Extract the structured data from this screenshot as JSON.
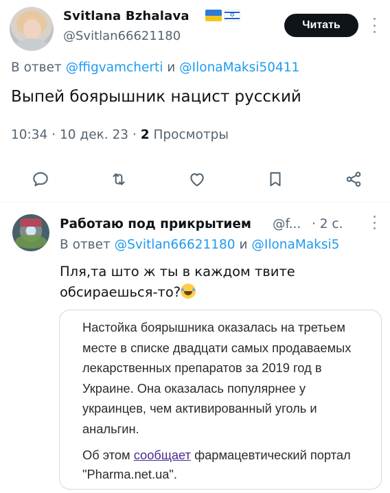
{
  "main_tweet": {
    "author_name": "Svitlana Bzhalava",
    "flags": [
      "ukraine-flag",
      "israel-flag"
    ],
    "handle": "@Svitlan66621180",
    "read_button": "Читать",
    "reply_prefix": "В ответ",
    "reply_mentions": [
      "@ffigvamcherti",
      "@IlonaMaksi50411"
    ],
    "reply_joiner": "и",
    "text": "Выпей боярышник нацист русский",
    "time": "10:34",
    "date": "10 дек. 23",
    "views_count": "2",
    "views_label": "Просмотры",
    "actions": [
      "reply-icon",
      "retweet-icon",
      "like-icon",
      "bookmark-icon",
      "share-icon"
    ]
  },
  "reply_tweet": {
    "author_name": "Работаю под прикрытием",
    "handle": "@f...",
    "time": "· 2 с.",
    "reply_prefix": "В ответ",
    "reply_mentions": [
      "@Svitlan66621180",
      "@IlonaMaksi5"
    ],
    "reply_joiner": "и",
    "text_line1": "Пля,та што ж ты в каждом твите",
    "text_line2": "обсираешься-то?",
    "emoji": "rolling-laughing-emoji",
    "quote": {
      "paragraph1": "Настойка боярышника оказалась на третьем месте в списке двадцати самых продаваемых лекарственных препаратов за 2019 год в Украине. Она оказалась популярнее у украинцев, чем активированный уголь и анальгин.",
      "p2_before": "Об этом",
      "p2_link": "сообщает",
      "p2_after": "фармацевтический портал \"Pharma.net.ua\"."
    }
  },
  "colors": {
    "accent": "#1d9bf0",
    "muted": "#536471",
    "button_bg": "#0f1419",
    "link_visited": "#4b2a94"
  }
}
